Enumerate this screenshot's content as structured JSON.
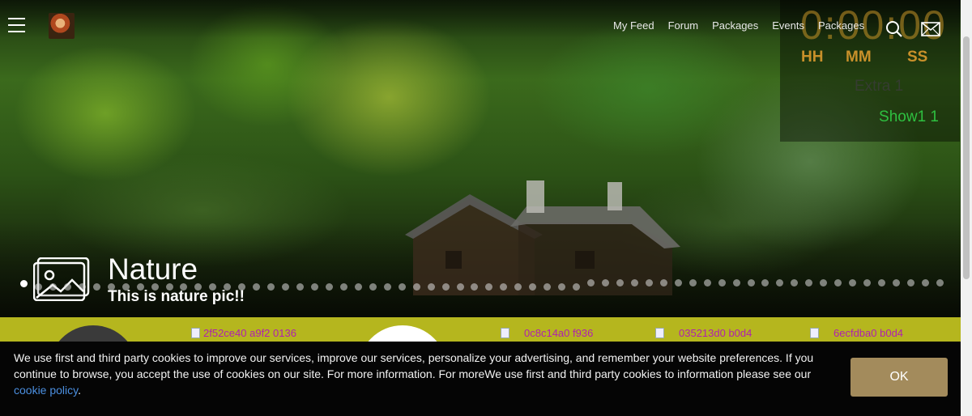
{
  "nav": {
    "items": [
      "My Feed",
      "Forum",
      "Packages",
      "Events",
      "Packages"
    ]
  },
  "countdown": {
    "value": "0:00:00",
    "units": [
      "HH",
      "MM",
      "SS"
    ],
    "extra": "Extra 1",
    "show": "Show1 1"
  },
  "slide": {
    "title": "Nature",
    "subtitle": "This is nature pic!!",
    "dot_count": 64,
    "active_dot": 0
  },
  "gallery": {
    "thumbs": [
      "2f52ce40 a9f2 0136",
      "0c8c14a0 f936",
      "035213d0 b0d4",
      "6ecfdba0 b0d4"
    ]
  },
  "cookie": {
    "text": "We use first and third party cookies to improve our services, improve our services, personalize your advertising, and remember your website preferences. If you continue to browse, you accept the use of cookies on our site. For more information. For moreWe use first and third party cookies to information please see our ",
    "link": "cookie policy",
    "after_link": ".",
    "ok_label": "OK"
  },
  "colors": {
    "accent_gold": "#c8902a",
    "show_green": "#2ec040",
    "strip_olive": "#b5b61e",
    "ok_button": "#a38b5c",
    "link_blue": "#4b8fe0"
  },
  "icons": [
    "menu-icon",
    "logo",
    "search-icon",
    "mail-icon",
    "image-icon"
  ]
}
